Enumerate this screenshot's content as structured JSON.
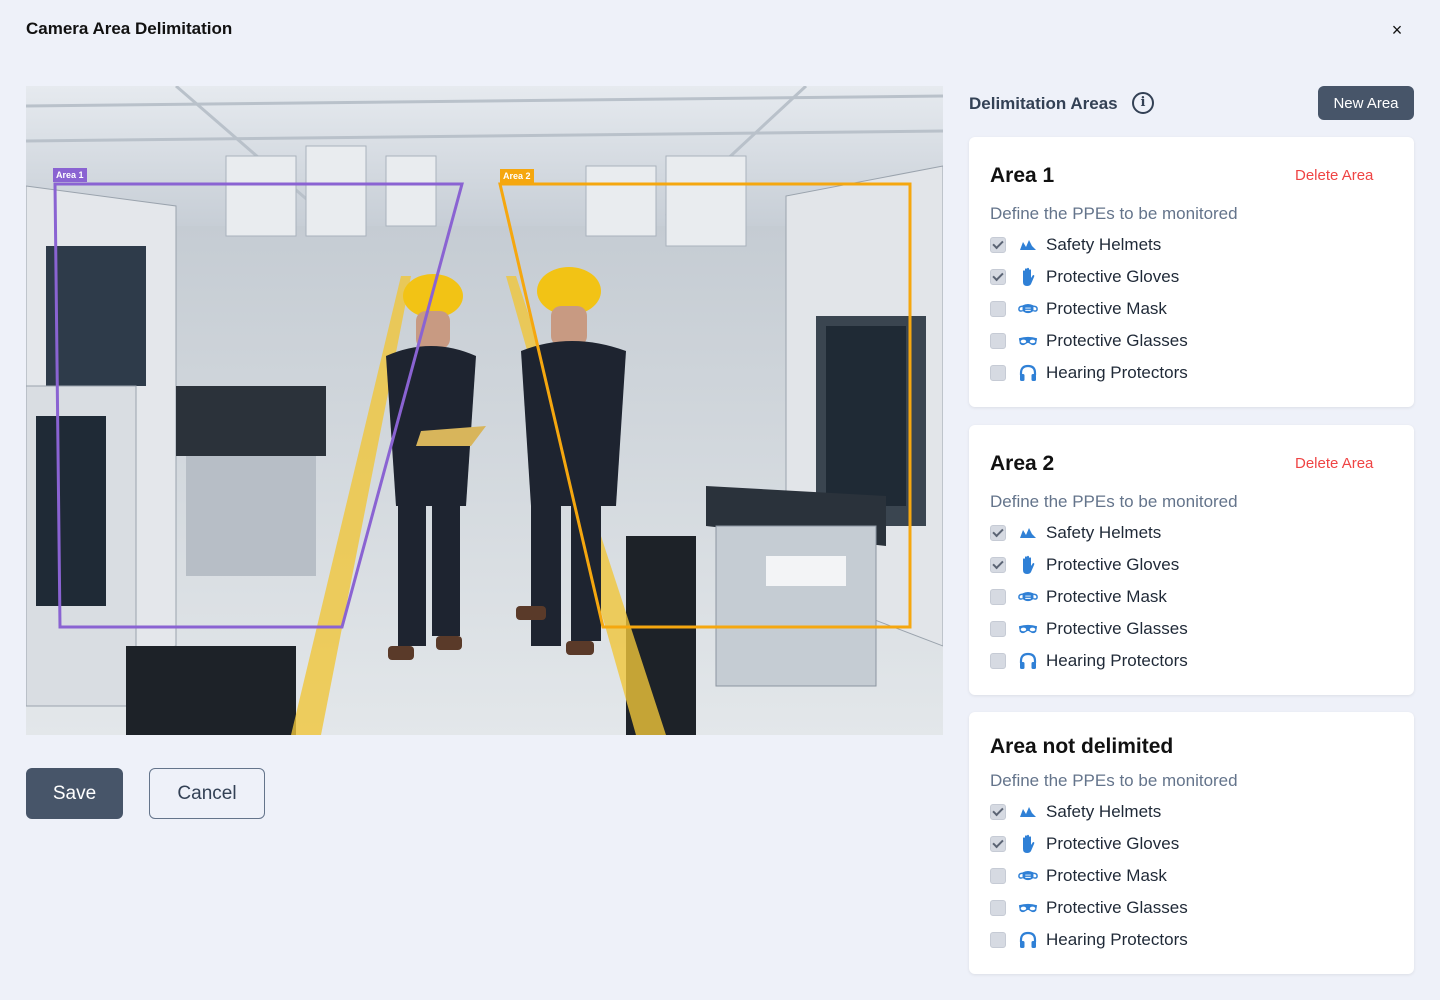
{
  "header": {
    "title": "Camera Area Delimitation",
    "close_glyph": "×"
  },
  "camera": {
    "areas": [
      {
        "label": "Area 1",
        "color": "#8a63d2"
      },
      {
        "label": "Area 2",
        "color": "#f5a70f"
      }
    ]
  },
  "actions": {
    "save_label": "Save",
    "cancel_label": "Cancel"
  },
  "panel": {
    "title": "Delimitation Areas",
    "info_glyph": "i",
    "new_area_label": "New Area"
  },
  "cards": [
    {
      "title": "Area 1",
      "delete_label": "Delete Area",
      "subtitle": "Define the PPEs to be monitored",
      "items": [
        {
          "label": "Safety Helmets",
          "checked": true,
          "icon": "helmet-icon"
        },
        {
          "label": "Protective Gloves",
          "checked": true,
          "icon": "glove-icon"
        },
        {
          "label": "Protective Mask",
          "checked": false,
          "icon": "mask-icon"
        },
        {
          "label": "Protective Glasses",
          "checked": false,
          "icon": "glasses-icon"
        },
        {
          "label": "Hearing Protectors",
          "checked": false,
          "icon": "headphones-icon"
        }
      ]
    },
    {
      "title": "Area 2",
      "delete_label": "Delete Area",
      "subtitle": "Define the PPEs to be monitored",
      "items": [
        {
          "label": "Safety Helmets",
          "checked": true,
          "icon": "helmet-icon"
        },
        {
          "label": "Protective Gloves",
          "checked": true,
          "icon": "glove-icon"
        },
        {
          "label": "Protective Mask",
          "checked": false,
          "icon": "mask-icon"
        },
        {
          "label": "Protective Glasses",
          "checked": false,
          "icon": "glasses-icon"
        },
        {
          "label": "Hearing Protectors",
          "checked": false,
          "icon": "headphones-icon"
        }
      ]
    },
    {
      "title": "Area not delimited",
      "subtitle": "Define the PPEs to be monitored",
      "items": [
        {
          "label": "Safety Helmets",
          "checked": true,
          "icon": "helmet-icon"
        },
        {
          "label": "Protective Gloves",
          "checked": true,
          "icon": "glove-icon"
        },
        {
          "label": "Protective Mask",
          "checked": false,
          "icon": "mask-icon"
        },
        {
          "label": "Protective Glasses",
          "checked": false,
          "icon": "glasses-icon"
        },
        {
          "label": "Hearing Protectors",
          "checked": false,
          "icon": "headphones-icon"
        }
      ]
    }
  ],
  "icon_color": "#2f80d6"
}
